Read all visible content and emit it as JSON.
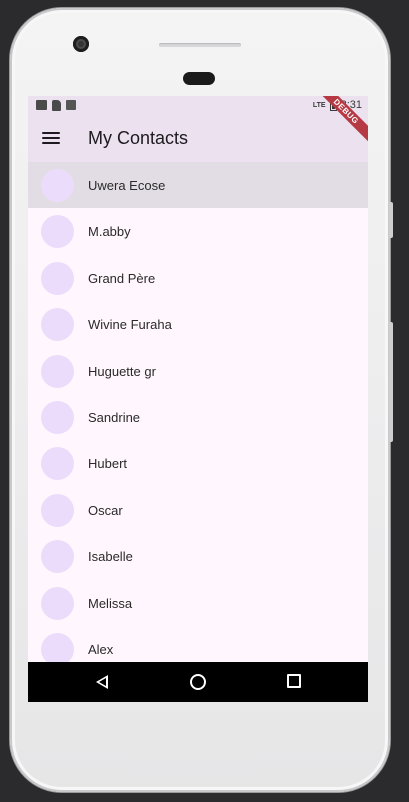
{
  "status_bar": {
    "time": "2:31",
    "network": "LTE"
  },
  "app_bar": {
    "title": "My Contacts"
  },
  "debug_banner": "DEBUG",
  "contacts": [
    "Uwera Ecose",
    "M.abby",
    "Grand Père",
    "Wivine Furaha",
    "Huguette gr",
    "Sandrine",
    "Hubert",
    "Oscar",
    "Isabelle",
    "Melissa",
    "Alex"
  ],
  "colors": {
    "app_bar_bg": "#ebe1ef",
    "screen_bg": "#fff7fd",
    "avatar": "#ebdcfc",
    "selected_row": "#e2dde4",
    "debug_banner": "#b53a43"
  }
}
